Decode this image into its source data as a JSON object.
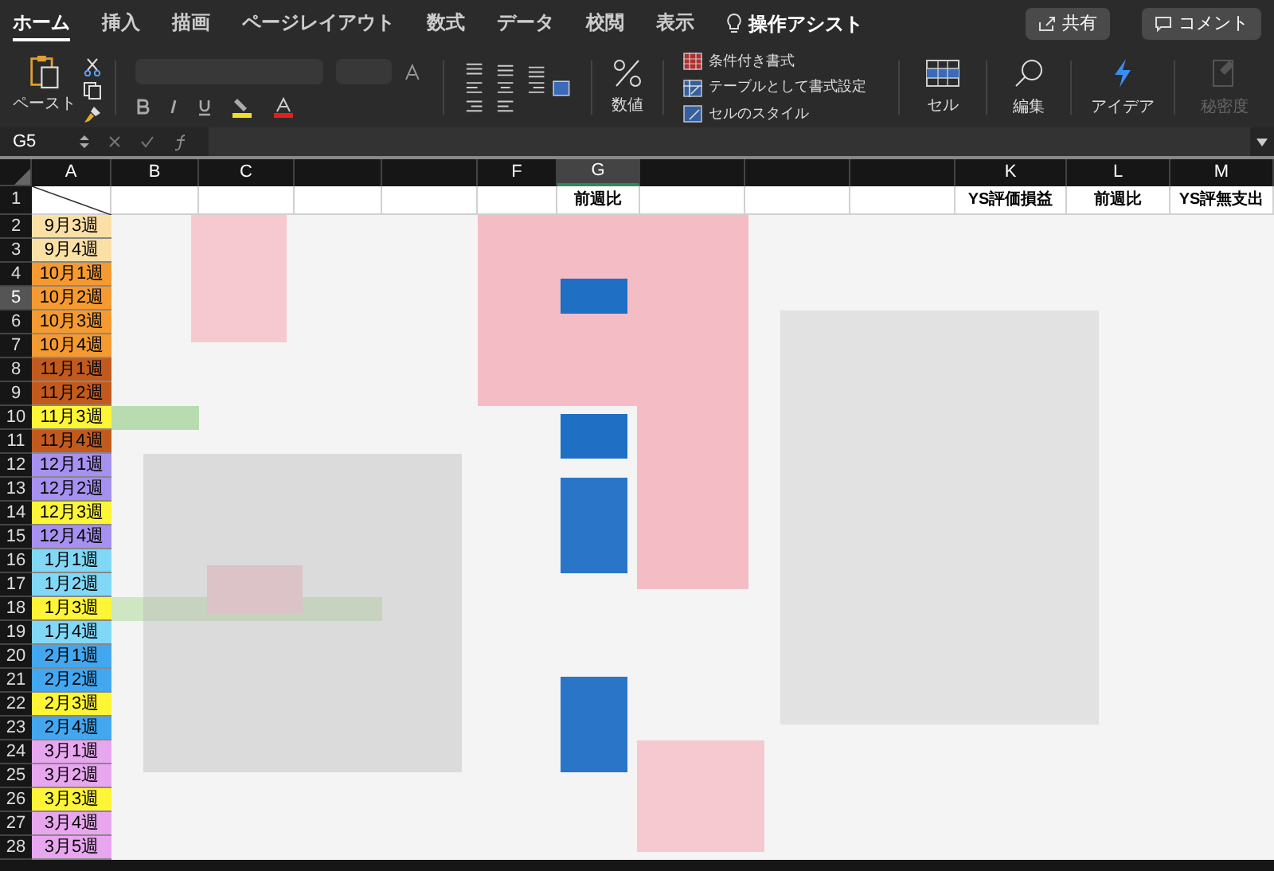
{
  "ribbon_tabs": [
    {
      "label": "ホーム",
      "selected": true
    },
    {
      "label": "挿入",
      "selected": false
    },
    {
      "label": "描画",
      "selected": false
    },
    {
      "label": "ページレイアウト",
      "selected": false
    },
    {
      "label": "数式",
      "selected": false
    },
    {
      "label": "データ",
      "selected": false
    },
    {
      "label": "校閲",
      "selected": false
    },
    {
      "label": "表示",
      "selected": false
    }
  ],
  "tell_me": "操作アシスト",
  "share_button": "共有",
  "comment_button": "コメント",
  "ribbon": {
    "paste": "ペースト",
    "number": "数値",
    "styles": [
      {
        "label": "条件付き書式",
        "kind": "conditional"
      },
      {
        "label": "テーブルとして書式設定",
        "kind": "table"
      },
      {
        "label": "セルのスタイル",
        "kind": "cell"
      }
    ],
    "cells": "セル",
    "editing": "編集",
    "ideas": "アイデア",
    "sensitivity": {
      "label": "秘密度",
      "disabled": true
    }
  },
  "formula_bar": {
    "name_box": "G5"
  },
  "header_row_number": "1",
  "columns": [
    {
      "letter": "A",
      "selected": false
    },
    {
      "letter": "B",
      "selected": false
    },
    {
      "letter": "C",
      "selected": false
    },
    {
      "selected": false
    },
    {
      "selected": false
    },
    {
      "letter": "F",
      "selected": false
    },
    {
      "letter": "G",
      "header": "前週比",
      "selected": true
    },
    {
      "selected": false
    },
    {
      "selected": false
    },
    {
      "selected": false
    },
    {
      "letter": "K",
      "header": "YS評価損益",
      "selected": false
    },
    {
      "letter": "L",
      "header": "前週比",
      "selected": false
    },
    {
      "letter": "M",
      "header": "YS評無支出",
      "selected": false
    }
  ],
  "rows": [
    {
      "number": "2",
      "label": "9月3週",
      "color": "#fbe0a6",
      "selected": false
    },
    {
      "number": "3",
      "label": "9月4週",
      "color": "#fbe0a6",
      "selected": false
    },
    {
      "number": "4",
      "label": "10月1週",
      "color": "#f59a30",
      "selected": false
    },
    {
      "number": "5",
      "label": "10月2週",
      "color": "#f59a30",
      "selected": true
    },
    {
      "number": "6",
      "label": "10月3週",
      "color": "#f59a30",
      "selected": false
    },
    {
      "number": "7",
      "label": "10月4週",
      "color": "#f59a30",
      "selected": false
    },
    {
      "number": "8",
      "label": "11月1週",
      "color": "#c25a1e",
      "selected": false
    },
    {
      "number": "9",
      "label": "11月2週",
      "color": "#c25a1e",
      "selected": false
    },
    {
      "number": "10",
      "label": "11月3週",
      "color": "#fdf535",
      "selected": false
    },
    {
      "number": "11",
      "label": "11月4週",
      "color": "#c25a1e",
      "selected": false
    },
    {
      "number": "12",
      "label": "12月1週",
      "color": "#a690f0",
      "selected": false
    },
    {
      "number": "13",
      "label": "12月2週",
      "color": "#a690f0",
      "selected": false
    },
    {
      "number": "14",
      "label": "12月3週",
      "color": "#fdf535",
      "selected": false
    },
    {
      "number": "15",
      "label": "12月4週",
      "color": "#a690f0",
      "selected": false
    },
    {
      "number": "16",
      "label": "1月1週",
      "color": "#80d8f6",
      "selected": false
    },
    {
      "number": "17",
      "label": "1月2週",
      "color": "#80d8f6",
      "selected": false
    },
    {
      "number": "18",
      "label": "1月3週",
      "color": "#fdf535",
      "selected": false
    },
    {
      "number": "19",
      "label": "1月4週",
      "color": "#80d8f6",
      "selected": false
    },
    {
      "number": "20",
      "label": "2月1週",
      "color": "#43a7ef",
      "selected": false
    },
    {
      "number": "21",
      "label": "2月2週",
      "color": "#43a7ef",
      "selected": false
    },
    {
      "number": "22",
      "label": "2月3週",
      "color": "#fdf535",
      "selected": false
    },
    {
      "number": "23",
      "label": "2月4週",
      "color": "#43a7ef",
      "selected": false
    },
    {
      "number": "24",
      "label": "3月1週",
      "color": "#e8a6ef",
      "selected": false
    },
    {
      "number": "25",
      "label": "3月2週",
      "color": "#e8a6ef",
      "selected": false
    },
    {
      "number": "26",
      "label": "3月3週",
      "color": "#fdf535",
      "selected": false
    },
    {
      "number": "27",
      "label": "3月4週",
      "color": "#e8a6ef",
      "selected": false
    },
    {
      "number": "28",
      "label": "3月5週",
      "color": "#e8a6ef",
      "selected": false
    }
  ]
}
